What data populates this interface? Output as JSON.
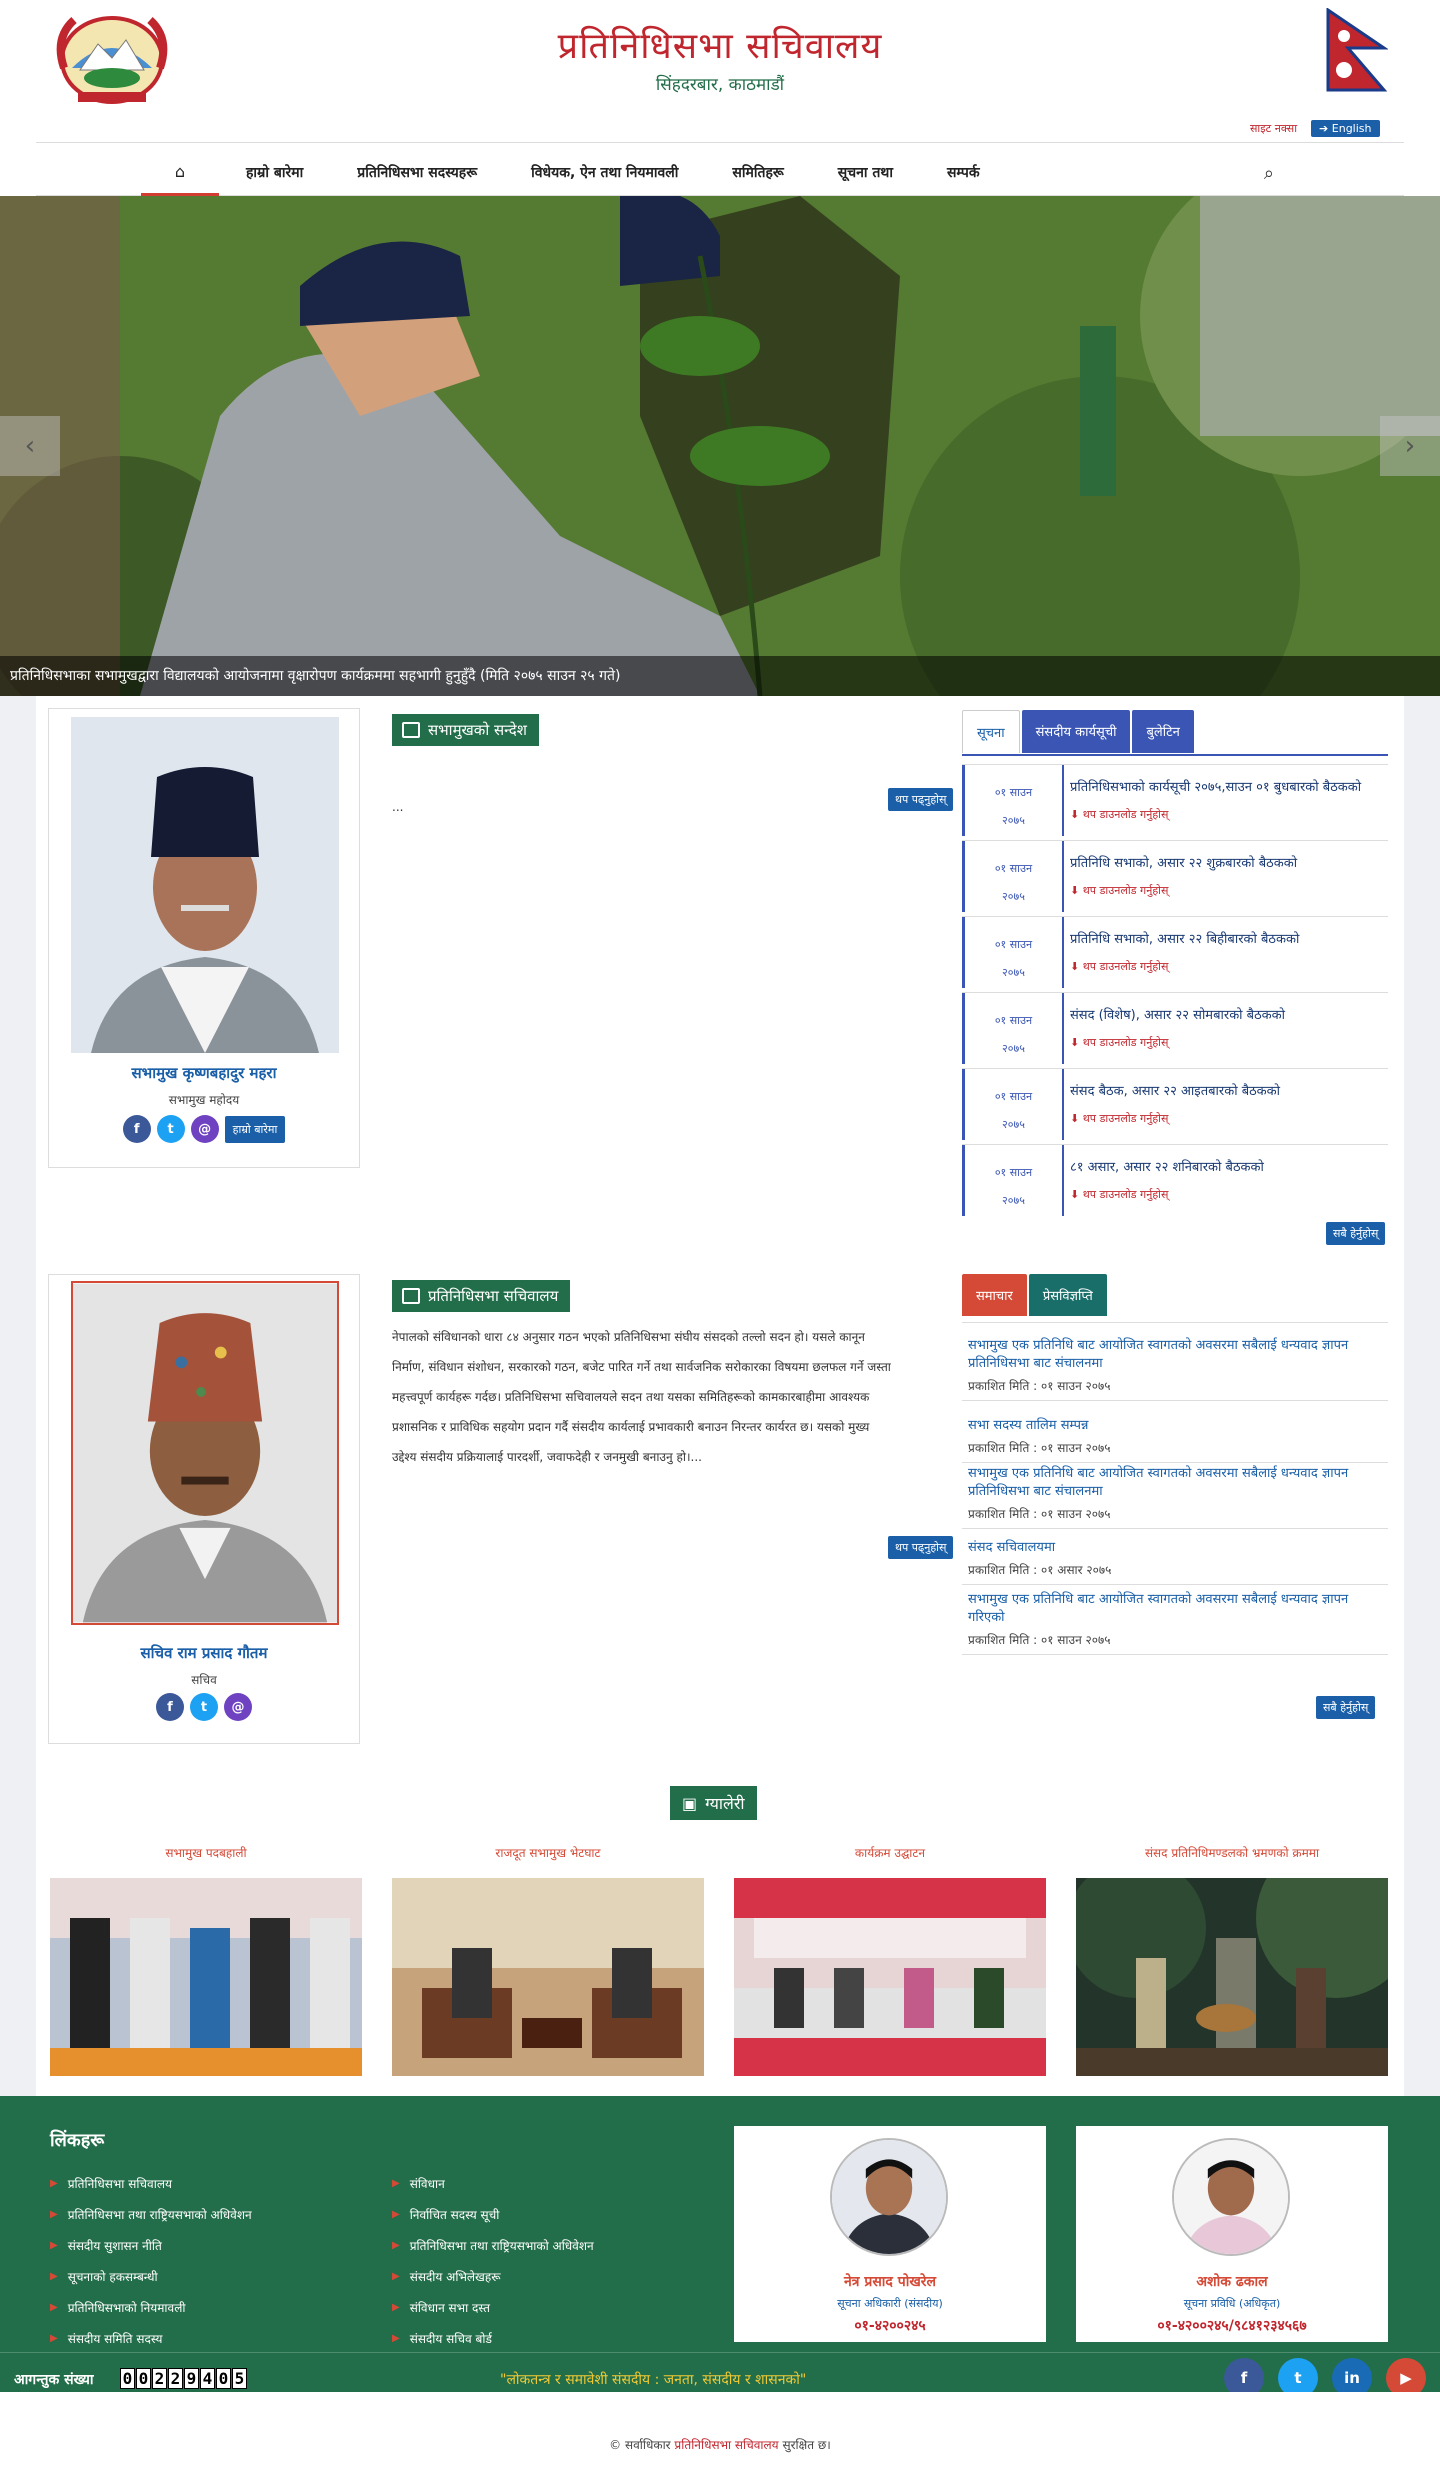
{
  "header": {
    "title": "प्रतिनिधिसभा सचिवालय",
    "subtitle": "सिंहदरबार, काठमाडौं",
    "sitemap": "साइट नक्सा",
    "english": "English"
  },
  "nav": {
    "items": [
      "हाम्रो बारेमा",
      "प्रतिनिधिसभा सदस्यहरू",
      "विधेयक, ऐन तथा नियमावली",
      "समितिहरू",
      "सूचना तथा",
      "सम्पर्क"
    ]
  },
  "hero": {
    "caption": "प्रतिनिधिसभाका सभामुखद्वारा विद्यालयको आयोजनामा वृक्षारोपण कार्यक्रममा सहभागी हुनुहुँदै (मिति २०७५ साउन २५ गते)",
    "prev": "‹",
    "next": "›"
  },
  "speaker": {
    "name": "सभामुख कृष्णबहादुर महरा",
    "role": "सभामुख महोदय",
    "bio_btn": "हाम्रो बारेमा",
    "section_title": "सभामुखको सन्देश",
    "message": "...",
    "readmore": "थप पढ्नुहोस्"
  },
  "secretary": {
    "name": "सचिव राम प्रसाद गौतम",
    "role": "सचिव",
    "section_title": "प्रतिनिधिसभा सचिवालय",
    "message": "नेपालको संविधानको धारा ८४ अनुसार गठन भएको प्रतिनिधिसभा संघीय संसदको तल्लो सदन हो। यसले कानून निर्माण, संविधान संशोधन, सरकारको गठन, बजेट पारित गर्ने तथा सार्वजनिक सरोकारका विषयमा छलफल गर्ने जस्ता महत्त्वपूर्ण कार्यहरू गर्दछ। प्रतिनिधिसभा सचिवालयले सदन तथा यसका समितिहरूको कामकारबाहीमा आवश्यक प्रशासनिक र प्राविधिक सहयोग प्रदान गर्दै संसदीय कार्यलाई प्रभावकारी बनाउन निरन्तर कार्यरत छ। यसको मुख्य उद्देश्य संसदीय प्रक्रियालाई पारदर्शी, जवाफदेही र जनमुखी बनाउनु हो।...",
    "readmore": "थप पढ्नुहोस्"
  },
  "notice_tabs": [
    "सूचना",
    "संसदीय कार्यसूची",
    "बुलेटिन"
  ],
  "notices": [
    {
      "day": "०१ साउन",
      "year": "२०७५",
      "title": "प्रतिनिधिसभाको कार्यसूची २०७५,साउन ०१ बुधबारको बैठकको",
      "dl": "थप डाउनलोड गर्नुहोस्"
    },
    {
      "day": "०१ साउन",
      "year": "२०७५",
      "title": "प्रतिनिधि सभाको, असार २२ शुक्रबारको बैठकको",
      "dl": "थप डाउनलोड गर्नुहोस्"
    },
    {
      "day": "०१ साउन",
      "year": "२०७५",
      "title": "प्रतिनिधि सभाको, असार २२ बिहीबारको बैठकको",
      "dl": "थप डाउनलोड गर्नुहोस्"
    },
    {
      "day": "०१ साउन",
      "year": "२०७५",
      "title": "संसद (विशेष), असार २२ सोमबारको बैठकको",
      "dl": "थप डाउनलोड गर्नुहोस्"
    },
    {
      "day": "०१ साउन",
      "year": "२०७५",
      "title": "संसद बैठक, असार २२ आइतबारको बैठकको",
      "dl": "थप डाउनलोड गर्नुहोस्"
    },
    {
      "day": "०१ साउन",
      "year": "२०७५",
      "title": "८१ असार, असार २२ शनिबारको बैठकको",
      "dl": "थप डाउनलोड गर्नुहोस्"
    }
  ],
  "notices_all": "सबै हेर्नुहोस्",
  "news_tabs": [
    "समाचार",
    "प्रेसविज्ञप्ति"
  ],
  "news": [
    {
      "title": "सभामुख एक प्रतिनिधि बाट आयोजित स्वागतको अवसरमा सबैलाई धन्यवाद ज्ञापन प्रतिनिधिसभा बाट संचालनमा",
      "date": "प्रकाशित मिति : ०१ साउन २०७५"
    },
    {
      "title": "सभा सदस्य तालिम सम्पन्न",
      "date": "प्रकाशित मिति : ०१ साउन २०७५"
    },
    {
      "title": "सभामुख एक प्रतिनिधि बाट आयोजित स्वागतको अवसरमा सबैलाई धन्यवाद ज्ञापन प्रतिनिधिसभा बाट संचालनमा",
      "date": "प्रकाशित मिति : ०१ साउन २०७५"
    },
    {
      "title": "संसद सचिवालयमा",
      "date": "प्रकाशित मिति : ०१ असार २०७५"
    },
    {
      "title": "सभामुख एक प्रतिनिधि बाट आयोजित स्वागतको अवसरमा सबैलाई धन्यवाद ज्ञापन गरिएको",
      "date": "प्रकाशित मिति : ०१ साउन २०७५"
    }
  ],
  "news_all": "सबै हेर्नुहोस्",
  "gallery": {
    "title": "ग्यालेरी",
    "items": [
      "सभामुख पदबहाली",
      "राजदूत सभामुख भेटघाट",
      "कार्यक्रम उद्घाटन",
      "संसद प्रतिनिधिमण्डलको भ्रमणको क्रममा"
    ]
  },
  "footer": {
    "title": "लिंकहरू",
    "links_col1": [
      "प्रतिनिधिसभा सचिवालय",
      "प्रतिनिधिसभा तथा राष्ट्रियसभाको अधिवेशन",
      "संसदीय सुशासन नीति",
      "सूचनाको हकसम्बन्धी",
      "प्रतिनिधिसभाको नियमावली",
      "संसदीय समिति सदस्य"
    ],
    "links_col2": [
      "संविधान",
      "निर्वाचित सदस्य सूची",
      "प्रतिनिधिसभा तथा राष्ट्रियसभाको अधिवेशन",
      "संसदीय अभिलेखहरू",
      "संविधान सभा दस्त",
      "संसदीय सचिव बोर्ड"
    ],
    "officers": [
      {
        "name": "नेत्र प्रसाद पोखरेल",
        "role": "सूचना अधिकारी (संसदीय)",
        "phone": "०१-४२००२४५"
      },
      {
        "name": "अशोक ढकाल",
        "role": "सूचना प्रविधि (अधिकृत)",
        "phone": "०१-४२००२४५/९८४१२३४५६७"
      }
    ],
    "counter_label": "आगन्तुक संख्या",
    "counter": "00229405",
    "motto": "\"लोकतन्त्र र समावेशी संसदीय : जनता, संसदीय र शासनको\"",
    "copyright_pre": "© सर्वाधिकार",
    "copyright_org": "प्रतिनिधिसभा सचिवालय",
    "copyright_post": "सुरक्षित छ।"
  }
}
